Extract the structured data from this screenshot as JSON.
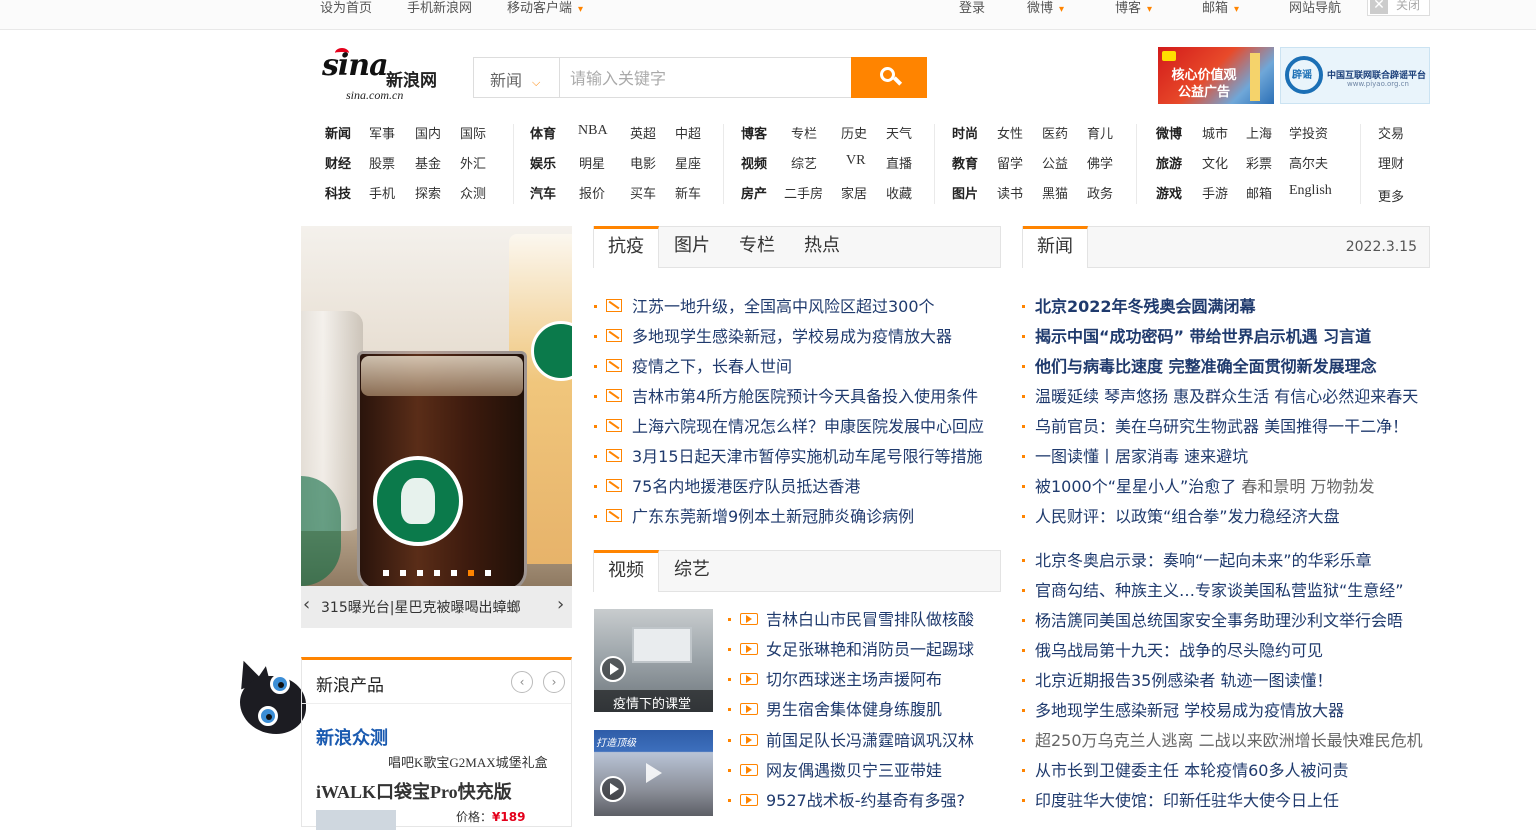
{
  "topbar": {
    "home": "设为首页",
    "mobile_sina": "手机新浪网",
    "mobile_client": "移动客户端",
    "login": "登录",
    "weibo": "微博",
    "blog": "博客",
    "mail": "邮箱",
    "sitenav": "网站导航",
    "close": "关闭"
  },
  "logo": {
    "text": "sina",
    "cn": "新浪网",
    "domain": "sina.com.cn"
  },
  "search": {
    "category": "新闻",
    "placeholder": "请输入关键字"
  },
  "ads": {
    "ad1": "核心价值观公益广告",
    "ad2_seal": "辟谣",
    "ad2_title": "中国互联网联合辟谣平台",
    "ad2_url": "www.piyao.org.cn"
  },
  "nav": {
    "g1": [
      [
        "新闻",
        "军事",
        "国内",
        "国际"
      ],
      [
        "财经",
        "股票",
        "基金",
        "外汇"
      ],
      [
        "科技",
        "手机",
        "探索",
        "众测"
      ]
    ],
    "g2": [
      [
        "体育",
        "NBA",
        "英超",
        "中超"
      ],
      [
        "娱乐",
        "明星",
        "电影",
        "星座"
      ],
      [
        "汽车",
        "报价",
        "买车",
        "新车"
      ]
    ],
    "g3": [
      [
        "博客",
        "专栏",
        "历史",
        "天气"
      ],
      [
        "视频",
        "综艺",
        "VR",
        "直播"
      ],
      [
        "房产",
        "二手房",
        "家居",
        "收藏"
      ]
    ],
    "g4": [
      [
        "时尚",
        "女性",
        "医药",
        "育儿"
      ],
      [
        "教育",
        "留学",
        "公益",
        "佛学"
      ],
      [
        "图片",
        "读书",
        "黑猫",
        "政务"
      ]
    ],
    "g5": [
      [
        "微博",
        "城市",
        "上海",
        "学投资"
      ],
      [
        "旅游",
        "文化",
        "彩票",
        "高尔夫"
      ],
      [
        "游戏",
        "手游",
        "邮箱",
        "English"
      ]
    ],
    "g6": [
      "交易",
      "理财",
      "更多"
    ]
  },
  "slider": {
    "caption": "315曝光台|星巴克被曝喝出蟑螂",
    "dot_count": 7,
    "active_dot": 5
  },
  "products": {
    "title": "新浪产品",
    "zhongce": "新浪众测",
    "item1": "唱吧K歌宝G2MAX城堡礼盒",
    "item2": "iWALK口袋宝Pro快充版",
    "price_label": "价格：",
    "price": "¥189"
  },
  "mid_tabs": [
    "抗疫",
    "图片",
    "专栏",
    "热点"
  ],
  "mid_news": [
    "江苏一地升级，全国高中风险区超过300个",
    "多地现学生感染新冠，学校易成为疫情放大器",
    "疫情之下，长春人世间",
    "吉林市第4所方舱医院预计今天具备投入使用条件",
    "上海六院现在情况怎么样？申康医院发展中心回应",
    "3月15日起天津市暂停实施机动车尾号限行等措施",
    "75名内地援港医疗队员抵达香港",
    "广东东莞新增9例本土新冠肺炎确诊病例"
  ],
  "video_tabs": [
    "视频",
    "综艺"
  ],
  "video_thumbs": {
    "t1_caption": "疫情下的课堂",
    "t2_caption": "打造顶级"
  },
  "video_news": [
    "吉林白山市民冒雪排队做核酸",
    "女足张琳艳和消防员一起踢球",
    "切尔西球迷主场声援阿布",
    "男生宿舍集体健身练腹肌",
    "前国足队长冯潇霆暗讽巩汉林",
    "网友偶遇擞贝宁三亚带娃",
    "9527战术板-约基奇有多强?"
  ],
  "right_tabs": {
    "tab": "新闻",
    "date": "2022.3.15"
  },
  "right_news_bold": [
    "北京2022年冬残奥会圆满闭幕",
    "揭示中国“成功密码” 带给世界启示机遇 习言道",
    "他们与病毒比速度 完整准确全面贯彻新发展理念"
  ],
  "right_news_a": [
    "温暖延续 琴声悠扬 惠及群众生活 有信心必然迎来春天",
    "乌前官员：美在乌研究生物武器 美国推得一干二净！",
    "一图读懂丨居家消毒 速来避坑"
  ],
  "right_news_mix": {
    "a": "被1000个“星星小人”治愈了",
    "b": "春和景明 万物勃发"
  },
  "right_news_b": [
    "人民财评：以政策“组合拳”发力稳经济大盘"
  ],
  "right_news_c": [
    "北京冬奥启示录：奏响“一起向未来”的华彩乐章",
    "官商勾结、种族主义…专家谈美国私营监狱“生意经”",
    "杨洁篪同美国总统国家安全事务助理沙利文举行会晤",
    "俄乌战局第十九天：战争的尽头隐约可见",
    "北京近期报告35例感染者 轨迹一图读懂！",
    "多地现学生感染新冠 学校易成为疫情放大器",
    "超250万乌克兰人逃离 二战以来欧洲增长最快难民危机",
    "从市长到卫健委主任 本轮疫情60多人被问责",
    "印度驻华大使馆：印新任驻华大使今日上任"
  ],
  "colors": {
    "accent": "#ff8400",
    "link": "#1f3a6d",
    "brand_red": "#e4001b"
  }
}
